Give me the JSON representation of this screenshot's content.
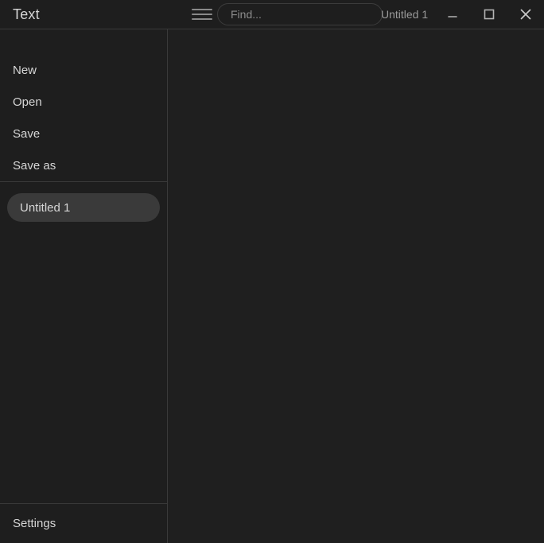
{
  "window": {
    "app_title": "Text",
    "document_title": "Untitled 1",
    "controls": {
      "minimize_label": "Minimize",
      "maximize_label": "Maximize",
      "close_label": "Close"
    }
  },
  "toolbar": {
    "menu_icon_label": "Menu",
    "find_placeholder": "Find...",
    "find_value": ""
  },
  "sidebar": {
    "menu_items": [
      {
        "label": "New"
      },
      {
        "label": "Open"
      },
      {
        "label": "Save"
      },
      {
        "label": "Save as"
      }
    ],
    "documents": [
      {
        "label": "Untitled 1",
        "selected": true
      }
    ],
    "settings_label": "Settings"
  },
  "editor": {
    "content": ""
  },
  "colors": {
    "background": "#1e1e1e",
    "editor_background": "#1f1f1f",
    "divider": "#3a3a3a",
    "text_primary": "#d6d6d6",
    "text_muted": "#9a9a9a",
    "selection": "#3a3a3a"
  }
}
